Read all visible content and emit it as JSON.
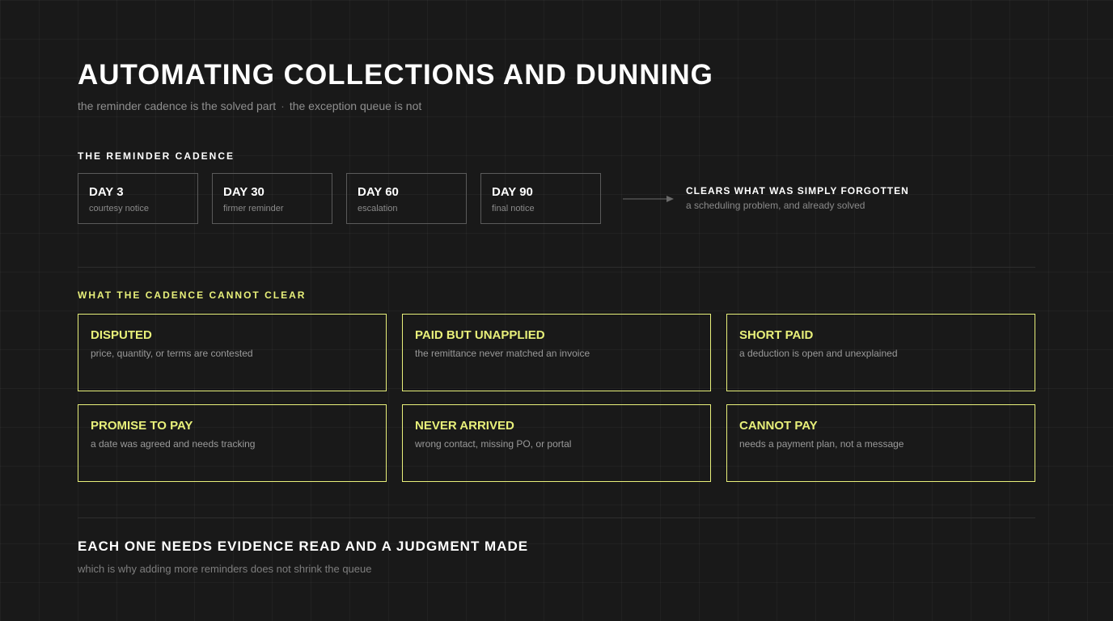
{
  "header": {
    "title": "AUTOMATING COLLECTIONS AND DUNNING",
    "subtitle_left": "the reminder cadence is the solved part",
    "subtitle_sep": "·",
    "subtitle_right": "the exception queue is not"
  },
  "cadence": {
    "label": "THE REMINDER CADENCE",
    "days": [
      {
        "title": "DAY 3",
        "sub": "courtesy notice"
      },
      {
        "title": "DAY 30",
        "sub": "firmer reminder"
      },
      {
        "title": "DAY 60",
        "sub": "escalation"
      },
      {
        "title": "DAY 90",
        "sub": "final notice"
      }
    ],
    "result_title": "CLEARS WHAT WAS SIMPLY FORGOTTEN",
    "result_sub": "a scheduling problem, and already solved"
  },
  "exceptions": {
    "label": "WHAT THE CADENCE CANNOT CLEAR",
    "items": [
      {
        "title": "DISPUTED",
        "sub": "price, quantity, or terms are contested"
      },
      {
        "title": "PAID BUT UNAPPLIED",
        "sub": "the remittance never matched an invoice"
      },
      {
        "title": "SHORT PAID",
        "sub": "a deduction is open and unexplained"
      },
      {
        "title": "PROMISE TO PAY",
        "sub": "a date was agreed and needs tracking"
      },
      {
        "title": "NEVER ARRIVED",
        "sub": "wrong contact, missing PO, or portal"
      },
      {
        "title": "CANNOT PAY",
        "sub": "needs a payment plan, not a message"
      }
    ]
  },
  "footer": {
    "title": "EACH ONE NEEDS EVIDENCE READ AND A JUDGMENT MADE",
    "sub": "which is why adding more reminders does not shrink the queue"
  },
  "colors": {
    "accent": "#e8f07a",
    "background": "#191919",
    "box_border": "#5a5a5a"
  },
  "icons": {
    "arrow": "arrow-right-icon"
  }
}
